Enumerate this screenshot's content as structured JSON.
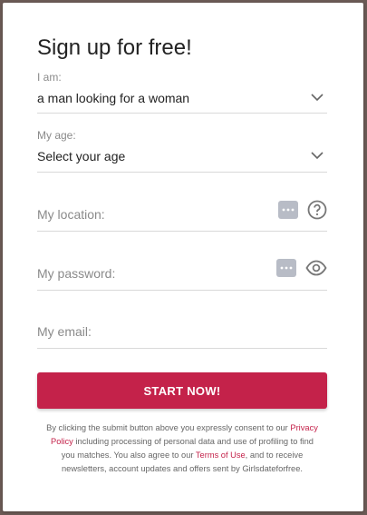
{
  "form": {
    "title": "Sign up for free!",
    "iam": {
      "label": "I am:",
      "value": "a man looking for a woman"
    },
    "age": {
      "label": "My age:",
      "value": "Select your age"
    },
    "location": {
      "placeholder": "My location:"
    },
    "password": {
      "placeholder": "My password:"
    },
    "email": {
      "placeholder": "My email:"
    },
    "submit_label": "START NOW!",
    "consent": {
      "part1": "By clicking the submit button above you expressly consent to our ",
      "privacy_link": "Privacy Policy",
      "part2": " including processing of personal data and use of profiling to find you matches. You also agree to our ",
      "terms_link": "Terms of Use",
      "part3": ", and to receive newsletters, account updates and offers sent by Girlsdateforfree."
    }
  },
  "colors": {
    "accent": "#c4224a",
    "background": "#6b5a55",
    "icon_gray": "#b8bcc6"
  },
  "icons": [
    "chevron-down-icon",
    "more-dots-icon",
    "help-circle-icon",
    "eye-icon"
  ]
}
